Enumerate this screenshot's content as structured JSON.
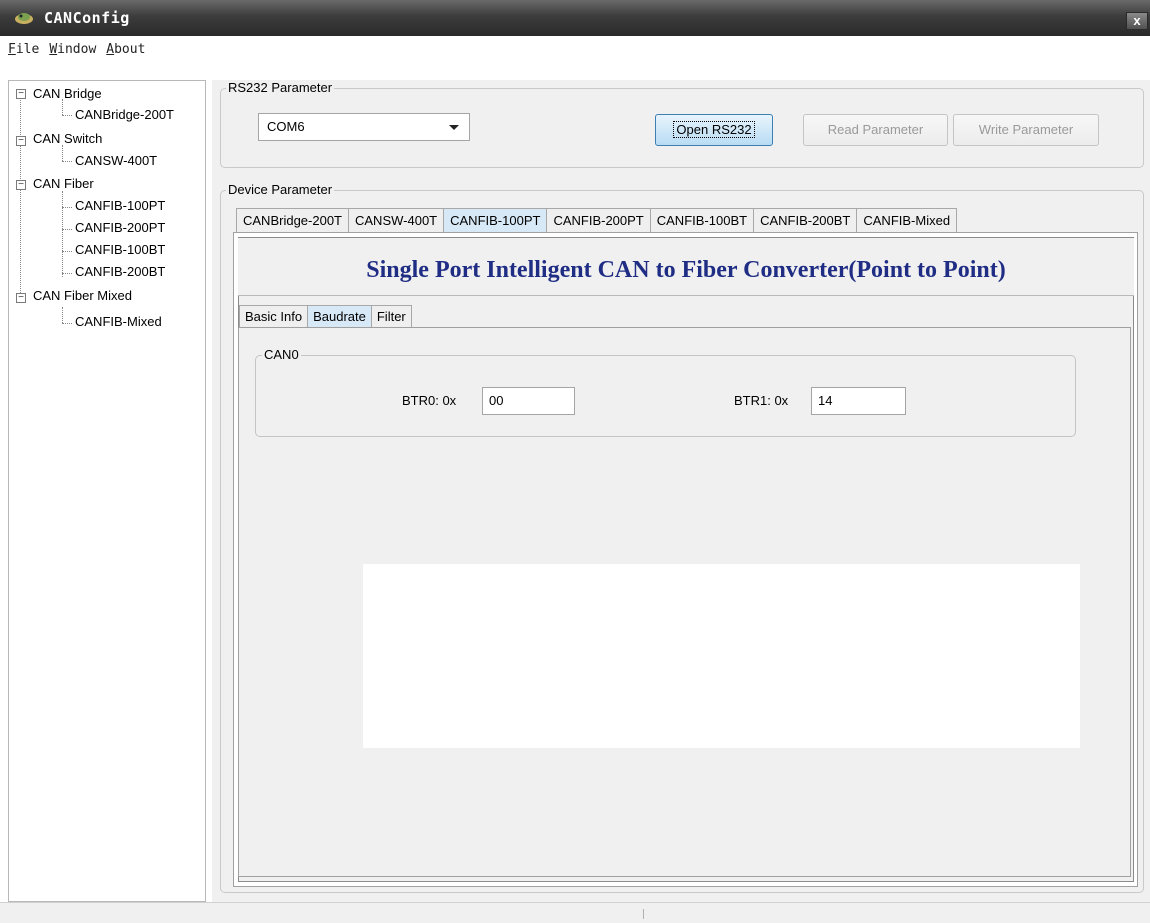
{
  "window": {
    "title": "CANConfig",
    "close_label": "x"
  },
  "menu": [
    "File",
    "Window",
    "About"
  ],
  "tree": [
    {
      "label": "CAN Bridge",
      "children": [
        "CANBridge-200T"
      ]
    },
    {
      "label": "CAN Switch",
      "children": [
        "CANSW-400T"
      ]
    },
    {
      "label": "CAN Fiber",
      "children": [
        "CANFIB-100PT",
        "CANFIB-200PT",
        "CANFIB-100BT",
        "CANFIB-200BT"
      ]
    },
    {
      "label": "CAN Fiber Mixed",
      "children": [
        "CANFIB-Mixed"
      ]
    }
  ],
  "rs232": {
    "group_label": "RS232 Parameter",
    "port_value": "COM6",
    "open_label": "Open RS232",
    "read_label": "Read Parameter",
    "write_label": "Write Parameter"
  },
  "device": {
    "group_label": "Device Parameter",
    "tabs": [
      "CANBridge-200T",
      "CANSW-400T",
      "CANFIB-100PT",
      "CANFIB-200PT",
      "CANFIB-100BT",
      "CANFIB-200BT",
      "CANFIB-Mixed"
    ],
    "active_tab": 2,
    "banner": "Single Port Intelligent CAN to Fiber Converter(Point to Point)",
    "subtabs": [
      "Basic Info",
      "Baudrate",
      "Filter"
    ],
    "active_subtab": 1,
    "can0": {
      "group_label": "CAN0",
      "btr0_label": "BTR0: 0x",
      "btr0_value": "00",
      "btr1_label": "BTR1: 0x",
      "btr1_value": "14"
    }
  }
}
